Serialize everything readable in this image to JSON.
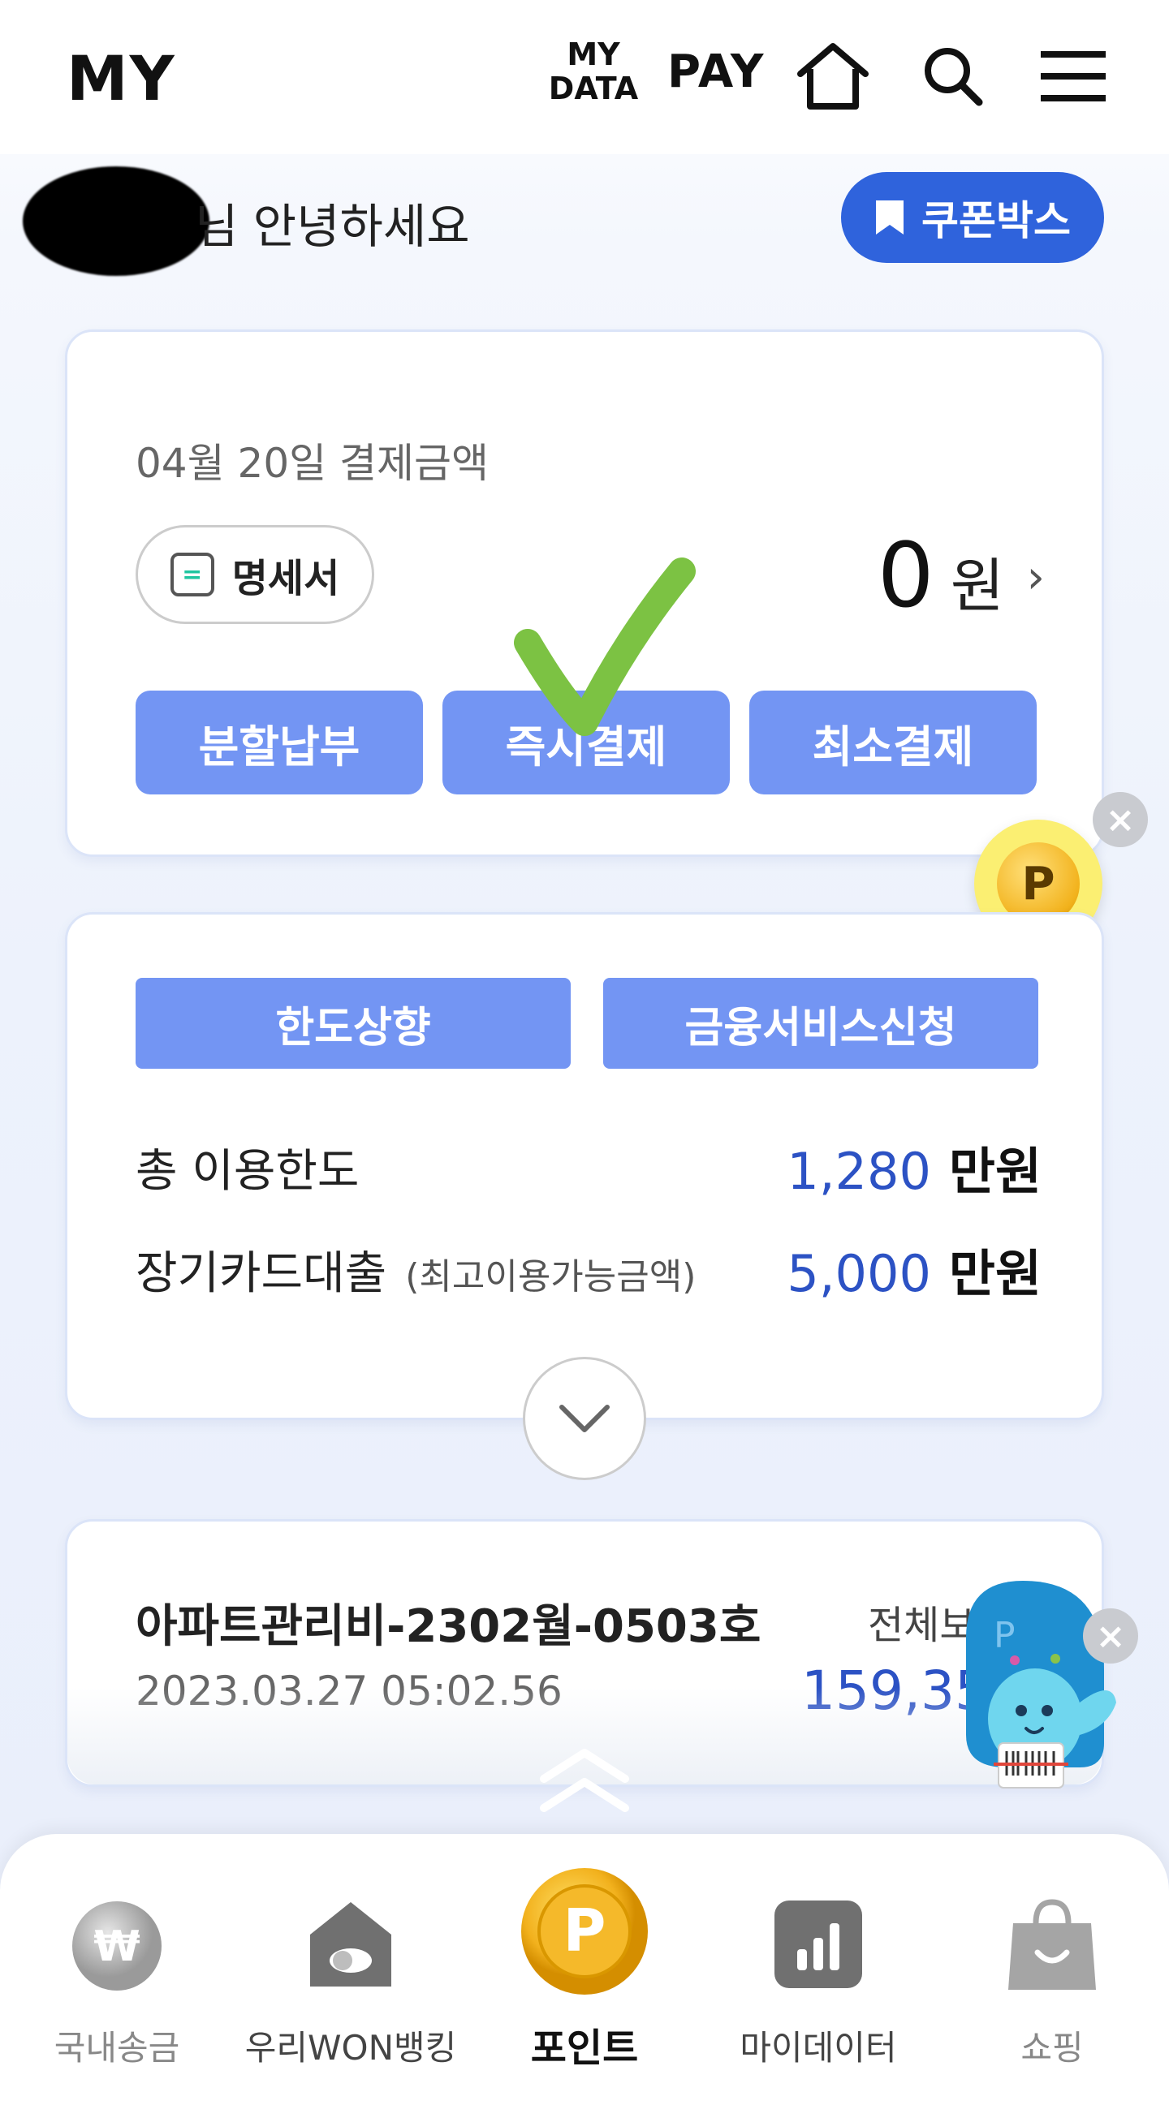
{
  "header": {
    "brand": "MY",
    "mydata_line1": "MY",
    "mydata_line2": "DATA",
    "pay": "PAY"
  },
  "greeting": {
    "text": "님 안녕하세요",
    "coupon_label": "쿠폰박스"
  },
  "payment": {
    "date_label": "04월 20일 결제금액",
    "statement_label": "명세서",
    "amount": "0",
    "amount_unit": "원",
    "buttons": [
      "분할납부",
      "즉시결제",
      "최소결제"
    ]
  },
  "limits": {
    "service_buttons": [
      "한도상향",
      "금융서비스신청"
    ],
    "total_limit_label": "총 이용한도",
    "total_limit_value": "1,280",
    "total_limit_unit": "만원",
    "card_loan_label": "장기카드대출",
    "card_loan_sub": "(최고이용가능금액)",
    "card_loan_value": "5,000",
    "card_loan_unit": "만원"
  },
  "transaction": {
    "title": "아파트관리비-2302월-0503호",
    "datetime": "2023.03.27 05:02.56",
    "status": "전체보",
    "amount": "159,35"
  },
  "floating": {
    "point_letter": "P",
    "close_symbol": "×"
  },
  "bottom_nav": {
    "items": [
      {
        "label": "국내송금",
        "icon": "won-coin-icon"
      },
      {
        "label": "우리WON뱅킹",
        "icon": "house-icon"
      },
      {
        "label": "포인트",
        "icon": "point-coin-icon"
      },
      {
        "label": "마이데이터",
        "icon": "bar-chart-icon"
      },
      {
        "label": "쇼핑",
        "icon": "shopping-bag-icon"
      }
    ]
  },
  "colors": {
    "accent_blue": "#2f63dc",
    "button_blue": "#7395f3",
    "value_blue": "#2c52c4",
    "check_green": "#7cc243",
    "point_yellow": "#fbef72"
  }
}
